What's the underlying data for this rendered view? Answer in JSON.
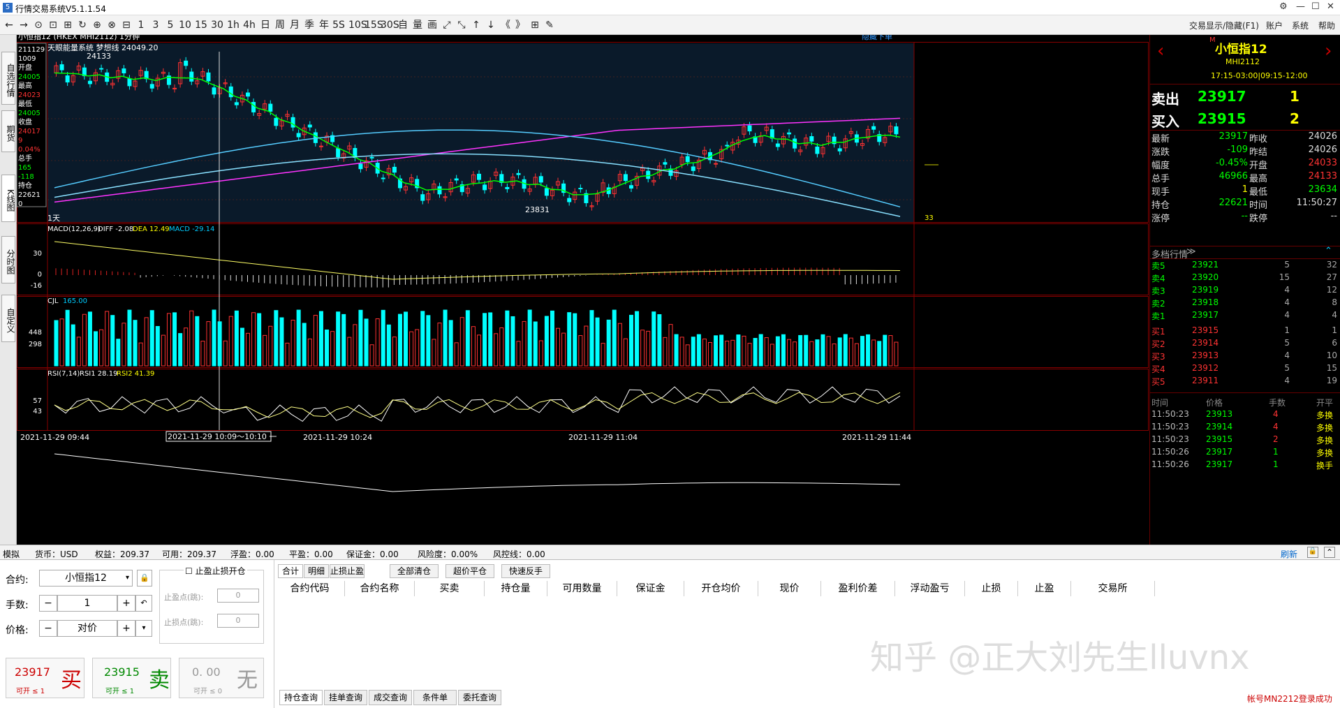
{
  "app": {
    "title": "行情交易系统V5.1.1.54",
    "logo": "5"
  },
  "window": {
    "right_items": [
      "交易显示/隐藏(F1)",
      "账户",
      "系统",
      "帮助"
    ]
  },
  "toolbar": {
    "items": [
      "←",
      "→",
      "⊙",
      "⊡",
      "⊞",
      "↻",
      "⊕",
      "⊗",
      "⊟",
      "1",
      "3",
      "5",
      "10",
      "15",
      "30",
      "1h",
      "4h",
      "日",
      "周",
      "月",
      "季",
      "年",
      "5S",
      "10S",
      "15S",
      "30S",
      "自",
      "量",
      "画",
      "⤢",
      "⤡",
      "↑",
      "↓",
      "《",
      "》",
      "⊞",
      "✎"
    ]
  },
  "left_tabs": [
    "自选行情",
    "期货",
    "K线图",
    "分时图",
    "自定义"
  ],
  "chart": {
    "instrument": "小恒指12 (HKEX MHI2112) 1分钟",
    "hide_order": "隐藏下单",
    "indicator_main": "天眼能量系统  梦想线 24049.20",
    "high_label": "24133",
    "low_label": "23831",
    "period_label": "1天",
    "right_value": "33",
    "info_box": [
      "211129",
      "1009",
      "开盘",
      "24005",
      "最高",
      "24023",
      "最低",
      "24005",
      "收盘",
      "24017",
      "9",
      "0.04%",
      "总手",
      "165",
      "-118",
      "持仓",
      "22621",
      "0"
    ],
    "macd": {
      "label": "MACD(12,26,9)",
      "diff": "DIFF -2.08",
      "dea": "DEA 12.49",
      "macd": "MACD -29.14",
      "ticks": [
        "30",
        "0",
        "-16"
      ]
    },
    "cjl": {
      "label": "CJL",
      "value": "165.00",
      "ticks": [
        "448",
        "298"
      ]
    },
    "rsi": {
      "label": "RSI(7,14)",
      "rsi1": "RSI1 28.19",
      "rsi2": "RSI2 41.39",
      "ticks": [
        "57",
        "43"
      ]
    },
    "time_axis": [
      "2021-11-29 09:44",
      "2021-11-29 10:24",
      "2021-11-29 11:04",
      "2021-11-29 11:44"
    ],
    "cursor_time": "2021-11-29  10:09～10:10 一"
  },
  "quote": {
    "name": "小恒指12",
    "code": "MHI2112",
    "session": "17:15-03:00|09:15-12:00",
    "m_mark": "M",
    "sell": {
      "label": "卖出",
      "price": "23917",
      "qty": "1"
    },
    "buy": {
      "label": "买入",
      "price": "23915",
      "qty": "2"
    },
    "stats": [
      [
        "最新",
        "23917",
        "昨收",
        "24026"
      ],
      [
        "涨跌",
        "-109",
        "昨结",
        "24026"
      ],
      [
        "幅度",
        "-0.45%",
        "开盘",
        "24033"
      ],
      [
        "总手",
        "46966",
        "最高",
        "24133"
      ],
      [
        "现手",
        "1",
        "最低",
        "23634"
      ],
      [
        "持仓",
        "22621",
        "时间",
        "11:50:27"
      ],
      [
        "涨停",
        "--",
        "跌停",
        "--"
      ]
    ],
    "depth_title": "多档行情",
    "asks": [
      [
        "卖5",
        "23921",
        "5",
        "32"
      ],
      [
        "卖4",
        "23920",
        "15",
        "27"
      ],
      [
        "卖3",
        "23919",
        "4",
        "12"
      ],
      [
        "卖2",
        "23918",
        "4",
        "8"
      ],
      [
        "卖1",
        "23917",
        "4",
        "4"
      ]
    ],
    "bids": [
      [
        "买1",
        "23915",
        "1",
        "1"
      ],
      [
        "买2",
        "23914",
        "5",
        "6"
      ],
      [
        "买3",
        "23913",
        "4",
        "10"
      ],
      [
        "买4",
        "23912",
        "5",
        "15"
      ],
      [
        "买5",
        "23911",
        "4",
        "19"
      ]
    ],
    "ticks_header": [
      "时间",
      "价格",
      "手数",
      "开平"
    ],
    "ticks": [
      [
        "11:50:23",
        "23913",
        "4",
        "多换"
      ],
      [
        "11:50:23",
        "23914",
        "4",
        "多换"
      ],
      [
        "11:50:23",
        "23915",
        "2",
        "多换"
      ],
      [
        "11:50:26",
        "23917",
        "1",
        "多换"
      ],
      [
        "11:50:26",
        "23917",
        "1",
        "换手"
      ]
    ]
  },
  "status": {
    "mode": "模拟",
    "currency": "货币：USD",
    "equity": "权益：209.37",
    "available": "可用：209.37",
    "float_pl": "浮盈：0.00",
    "close_pl": "平盈：0.00",
    "margin": "保证金：0.00",
    "risk": "风险度：0.00%",
    "risk_line": "风控线：0.00",
    "refresh": "刷新"
  },
  "order": {
    "contract_label": "合约:",
    "contract": "小恒指12",
    "qty_label": "手数:",
    "qty": "1",
    "price_label": "价格:",
    "price": "对价",
    "stop_title": "止盈止损开仓",
    "tp_label": "止盈点(跳):",
    "sl_label": "止损点(跳):",
    "tp": "0",
    "sl": "0",
    "buy_price": "23917",
    "buy_char": "买",
    "buy_sub": "可开 ≤ 1",
    "sell_price": "23915",
    "sell_char": "卖",
    "sell_sub": "可开 ≤ 1",
    "none_price": "0. 00",
    "none_char": "无",
    "none_sub": "可开 ≤ 0"
  },
  "positions": {
    "tabs": [
      "合计",
      "明细",
      "止损止盈"
    ],
    "actions": [
      "全部清仓",
      "超价平仓",
      "快速反手"
    ],
    "columns": [
      "合约代码",
      "合约名称",
      "买卖",
      "持仓量",
      "可用数量",
      "保证金",
      "开仓均价",
      "现价",
      "盈利价差",
      "浮动盈亏",
      "止损",
      "止盈",
      "交易所"
    ],
    "bottom_tabs": [
      "持仓查询",
      "挂单查询",
      "成交查询",
      "条件单",
      "委托查询"
    ],
    "watermark": "知乎 @正大刘先生lluvnx",
    "login_msg": "帐号MN2212登录成功"
  },
  "colors": {
    "up": "#ff3232",
    "down": "#00ffff",
    "bg": "#000000",
    "yellow": "#ffff00",
    "green": "#00ff00"
  }
}
